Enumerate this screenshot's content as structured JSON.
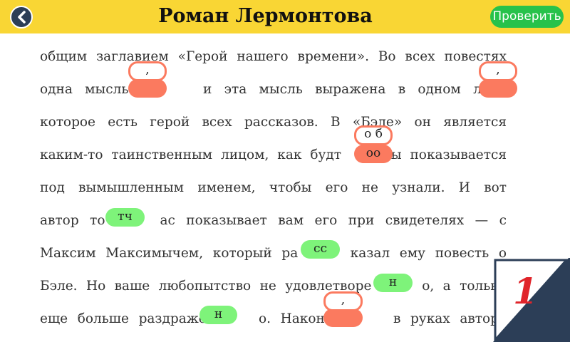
{
  "header": {
    "title": "Роман Лермонтова",
    "check_label": "Проверить",
    "back_icon": "back-arrow-icon"
  },
  "text_lines": [
    "общим заглавием «Герой нашего времени». Во всех повестях",
    "одна мысль   и эта мысль выражена в одном лице",
    "которое есть герой всех рассказов. В «Бэле» он является",
    "каким-то таинственным лицом, как будт   ы показывается",
    "под вымышленным именем, чтобы его не узнали. И вот",
    "автор то   ас показывает вам его при свидетелях — с",
    "Максим Максимычем, который ра   казал ему повесть о",
    "Бэле. Но ваше любопытство не удовлетворе   о, а только",
    "еще больше раздраже   о. Наконец   в руках автора"
  ],
  "answers": {
    "comma1": ",",
    "comma2": ",",
    "choice_ob": "о б",
    "choice_oo": "оо",
    "tch": "тч",
    "ss": "сс",
    "n1": "н",
    "n2": "н",
    "comma3": ","
  },
  "corner": {
    "number": "1"
  },
  "colors": {
    "header": "#f9d634",
    "check": "#27c24b",
    "correct": "#7ef37a",
    "wrong": "#fb7a5f",
    "corner": "#2c3e57",
    "number": "#e0242a"
  }
}
